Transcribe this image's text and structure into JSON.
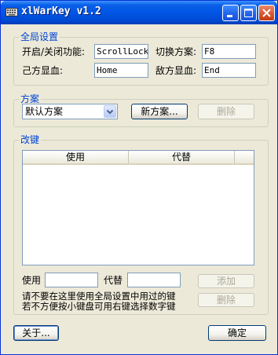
{
  "window": {
    "title": "xlWarKey v1.2"
  },
  "global_settings": {
    "group_label": "全局设置",
    "toggle_label": "开启/关闭功能:",
    "toggle_value": "ScrollLock",
    "switch_label": "切换方案:",
    "switch_value": "F8",
    "ally_label": "己方显血:",
    "ally_value": "Home",
    "enemy_label": "敌方显血:",
    "enemy_value": "End"
  },
  "scheme": {
    "group_label": "方案",
    "selected": "默认方案",
    "new_button": "新方案...",
    "delete_button": "删除"
  },
  "remap": {
    "group_label": "改键",
    "columns": [
      "使用",
      "代替"
    ],
    "rows": [],
    "use_label": "使用",
    "use_value": "",
    "replace_label": "代替",
    "replace_value": "",
    "add_button": "添加",
    "delete_button": "删除",
    "hint_line1": "请不要在这里使用全局设置中用过的键",
    "hint_line2": "若不方便按小键盘可用右键选择数字键"
  },
  "footer": {
    "about_button": "关于...",
    "ok_button": "确定"
  },
  "colors": {
    "title_blue": "#0055E5",
    "group_label_blue": "#0046D5",
    "face": "#ECE9D8"
  }
}
